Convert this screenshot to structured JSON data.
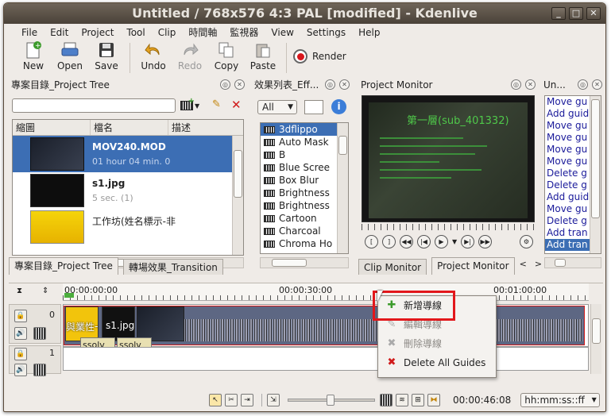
{
  "window": {
    "title": "Untitled / 768x576 4:3 PAL [modified] - Kdenlive"
  },
  "menu": [
    "File",
    "Edit",
    "Project",
    "Tool",
    "Clip",
    "時間軸",
    "監視器",
    "View",
    "Settings",
    "Help"
  ],
  "toolbar": {
    "new": "New",
    "open": "Open",
    "save": "Save",
    "undo": "Undo",
    "redo": "Redo",
    "copy": "Copy",
    "paste": "Paste",
    "render": "Render"
  },
  "project_tree": {
    "title": "專案目錄_Project Tree",
    "search_placeholder": "",
    "columns": [
      "縮圖",
      "檔名",
      "描述"
    ],
    "items": [
      {
        "name": "MOV240.MOD",
        "detail": "01 hour 04 min. 0",
        "selected": true
      },
      {
        "name": "s1.jpg",
        "detail": "5 sec. (1)",
        "selected": false
      },
      {
        "name": "工作坊(姓名標示-非",
        "detail": "",
        "selected": false
      }
    ],
    "tabs": [
      "專案目錄_Project Tree",
      "轉場效果_Transition"
    ]
  },
  "effects": {
    "title": "效果列表_Eff...",
    "filter": "All",
    "items": [
      "3dflippo",
      "Auto Mask",
      "B",
      "Blue Scree",
      "Box Blur",
      "Brightness",
      "Brightness",
      "Cartoon",
      "Charcoal",
      "Chroma Ho"
    ]
  },
  "monitor": {
    "title": "Project Monitor",
    "screen_heading": "第一層(sub_401332)",
    "tabs": [
      "Clip Monitor",
      "Project Monitor"
    ]
  },
  "undo_panel": {
    "title": "Un...",
    "items": [
      "Move gu",
      "Add guid",
      "Move gu",
      "Move gu",
      "Move gu",
      "Move gu",
      "Delete g",
      "Delete g",
      "Add guid",
      "Move gu",
      "Delete g",
      "Add tran",
      "Add tran"
    ]
  },
  "timeline": {
    "ruler": [
      "00:00:00:00",
      "00:00:30:00",
      "00:01:00:00"
    ],
    "tracks": [
      {
        "number": "0",
        "clips": [
          "與業性一禁",
          "s1.jpg"
        ],
        "transitions": [
          "ssolv",
          "ssolv"
        ]
      },
      {
        "number": "1",
        "clips": [],
        "transitions": []
      }
    ]
  },
  "context_menu": {
    "items": [
      {
        "label": "新增導線",
        "enabled": true,
        "icon": "add-guide-icon"
      },
      {
        "label": "編輯導線",
        "enabled": false,
        "icon": "edit-guide-icon"
      },
      {
        "label": "刪除導線",
        "enabled": false,
        "icon": "delete-guide-icon"
      },
      {
        "label": "Delete All Guides",
        "enabled": true,
        "icon": "delete-all-icon"
      }
    ]
  },
  "statusbar": {
    "timecode": "00:00:46:08",
    "format": "hh:mm:ss::ff"
  },
  "colors": {
    "selection": "#3c6eb4",
    "accent_red": "#e2171b",
    "title_bg": "#5b5248"
  }
}
